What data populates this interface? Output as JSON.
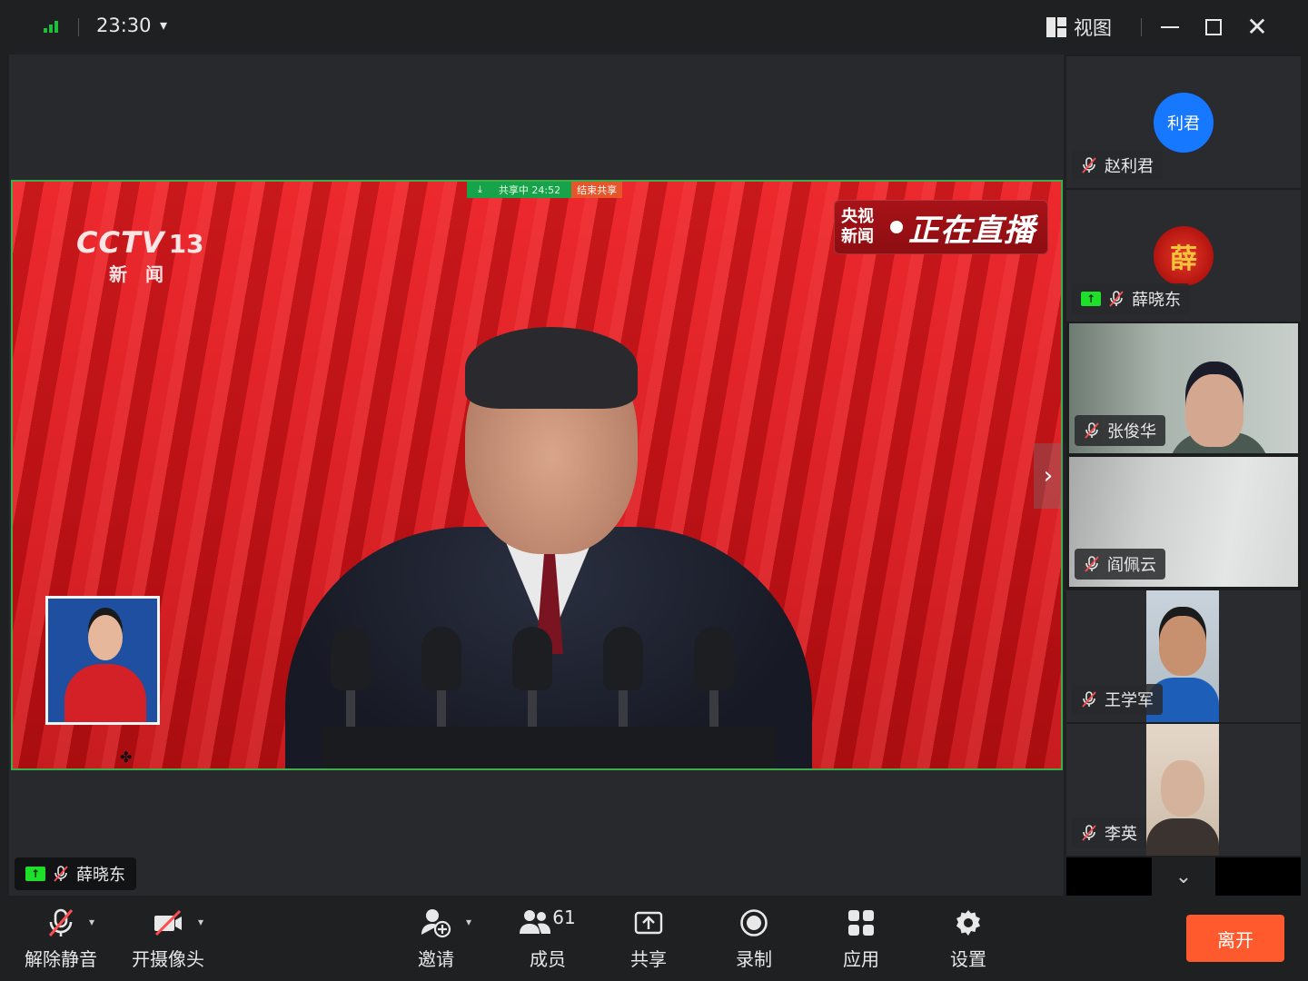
{
  "titlebar": {
    "time": "23:30",
    "view_label": "视图"
  },
  "share": {
    "status": "共享中 24:52",
    "end_label": "结束共享"
  },
  "broadcast": {
    "logo_main": "CCTV",
    "logo_channel": "13",
    "logo_sub": "新闻",
    "live_org_line1": "央视",
    "live_org_line2": "新闻",
    "live_text": "正在直播"
  },
  "presenter": {
    "name": "薛晓东"
  },
  "participants": [
    {
      "name": "赵利君",
      "avatar_text": "利君",
      "avatar_color": "#1677ff",
      "muted": true,
      "sharing": false
    },
    {
      "name": "薛晓东",
      "avatar_text": "薛",
      "muted": true,
      "sharing": true
    },
    {
      "name": "张俊华",
      "muted": true,
      "sharing": false
    },
    {
      "name": "阎佩云",
      "muted": true,
      "sharing": false
    },
    {
      "name": "王学军",
      "muted": true,
      "sharing": false
    },
    {
      "name": "李英",
      "muted": true,
      "sharing": false
    }
  ],
  "toolbar": {
    "unmute": "解除静音",
    "camera": "开摄像头",
    "invite": "邀请",
    "members": "成员",
    "member_count": "61",
    "share": "共享",
    "record": "录制",
    "apps": "应用",
    "settings": "设置",
    "leave": "离开"
  },
  "colors": {
    "accent_green": "#1ee02a",
    "leave_orange": "#ff5a2e",
    "avatar_blue": "#1677ff"
  }
}
